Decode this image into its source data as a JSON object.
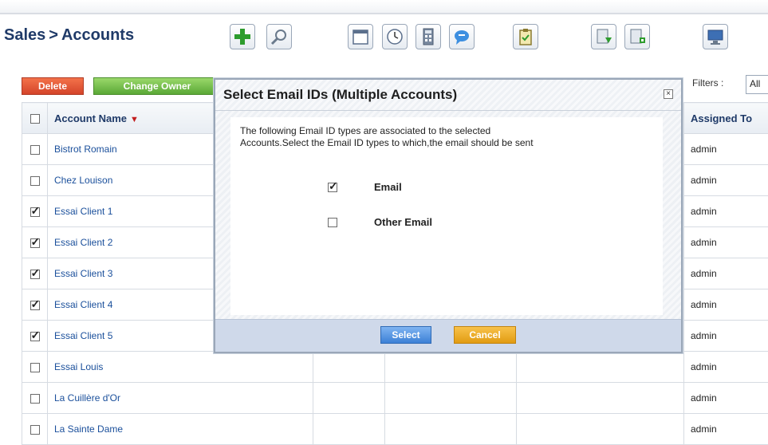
{
  "breadcrumb": {
    "module": "Sales",
    "separator": ">",
    "page": "Accounts"
  },
  "toolbar": {
    "icons": [
      "add-icon",
      "search-icon",
      "calendar-icon",
      "clock-icon",
      "calculator-icon",
      "chat-icon",
      "clipboard-icon",
      "import-icon",
      "export-icon",
      "monitor-icon"
    ]
  },
  "actions": {
    "delete_label": "Delete",
    "change_owner_label": "Change Owner"
  },
  "filters": {
    "label": "Filters :",
    "value": "All"
  },
  "table": {
    "headers": {
      "account_name": "Account Name",
      "assigned_to": "Assigned To"
    },
    "rows": [
      {
        "name": "Bistrot Romain",
        "checked": false,
        "assigned": "admin"
      },
      {
        "name": "Chez Louison",
        "checked": false,
        "assigned": "admin"
      },
      {
        "name": "Essai Client 1",
        "checked": true,
        "assigned": "admin"
      },
      {
        "name": "Essai Client 2",
        "checked": true,
        "assigned": "admin"
      },
      {
        "name": "Essai Client 3",
        "checked": true,
        "assigned": "admin"
      },
      {
        "name": "Essai Client 4",
        "checked": true,
        "assigned": "admin"
      },
      {
        "name": "Essai Client 5",
        "checked": true,
        "assigned": "admin"
      },
      {
        "name": "Essai Louis",
        "checked": false,
        "assigned": "admin"
      },
      {
        "name": "La Cuillère d'Or",
        "checked": false,
        "assigned": "admin"
      },
      {
        "name": "La Sainte Dame",
        "checked": false,
        "assigned": "admin"
      }
    ]
  },
  "modal": {
    "title": "Select Email IDs (Multiple Accounts)",
    "close_glyph": "×",
    "message_line1": "The following Email ID types are associated to the selected",
    "message_line2": "Accounts.Select the Email ID types to which,the email should be sent",
    "options": [
      {
        "label": "Email",
        "checked": true
      },
      {
        "label": "Other Email",
        "checked": false
      }
    ],
    "select_label": "Select",
    "cancel_label": "Cancel"
  },
  "colors": {
    "delete": "#d4442a",
    "change_owner": "#5aa836",
    "select": "#3c80d6",
    "cancel": "#e19b12",
    "link": "#1a4f9b",
    "heading": "#1f3a68"
  }
}
